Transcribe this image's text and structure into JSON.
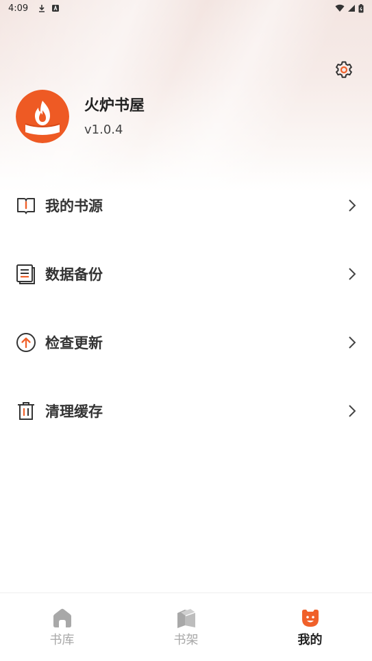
{
  "status_bar": {
    "time": "4:09"
  },
  "profile": {
    "app_name": "火炉书屋",
    "version": "v1.0.4"
  },
  "menu": [
    {
      "label": "我的书源",
      "icon": "book-source-icon"
    },
    {
      "label": "数据备份",
      "icon": "backup-icon"
    },
    {
      "label": "检查更新",
      "icon": "update-icon"
    },
    {
      "label": "清理缓存",
      "icon": "trash-icon"
    }
  ],
  "bottom_nav": {
    "items": [
      {
        "label": "书库",
        "icon": "home-icon",
        "active": false
      },
      {
        "label": "书架",
        "icon": "bookshelf-icon",
        "active": false
      },
      {
        "label": "我的",
        "icon": "profile-face-icon",
        "active": true
      }
    ]
  },
  "colors": {
    "accent": "#f0602a",
    "inactive": "#a8a8a8",
    "text": "#333333"
  }
}
